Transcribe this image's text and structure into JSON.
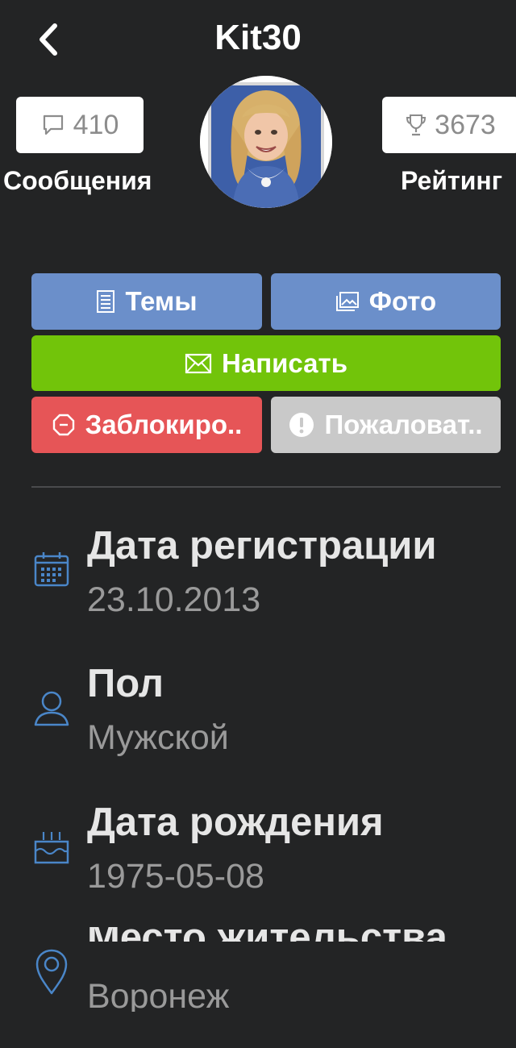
{
  "header": {
    "title": "Kit30",
    "back_icon": "chevron-left-icon"
  },
  "stats": {
    "messages": {
      "count": "410",
      "label": "Сообщения",
      "icon": "comment-icon"
    },
    "rating": {
      "count": "3673",
      "label": "Рейтинг",
      "icon": "trophy-icon"
    }
  },
  "actions": {
    "themes": "Темы",
    "photo": "Фото",
    "write": "Написать",
    "block": "Заблокиро..",
    "report": "Пожаловат.."
  },
  "colors": {
    "background": "#232425",
    "blue_button": "#6b8fca",
    "green_button": "#72c40a",
    "red_button": "#e65557",
    "grey_button": "#c9c9c9",
    "icon_blue": "#4a86c8"
  },
  "info": [
    {
      "title": "Дата регистрации",
      "value": "23.10.2013",
      "icon": "calendar-icon"
    },
    {
      "title": "Пол",
      "value": "Мужской",
      "icon": "user-icon"
    },
    {
      "title": "Дата рождения",
      "value": "1975-05-08",
      "icon": "birthday-cake-icon"
    },
    {
      "title": "Место жительства",
      "value": "Воронеж",
      "icon": "location-pin-icon"
    }
  ]
}
